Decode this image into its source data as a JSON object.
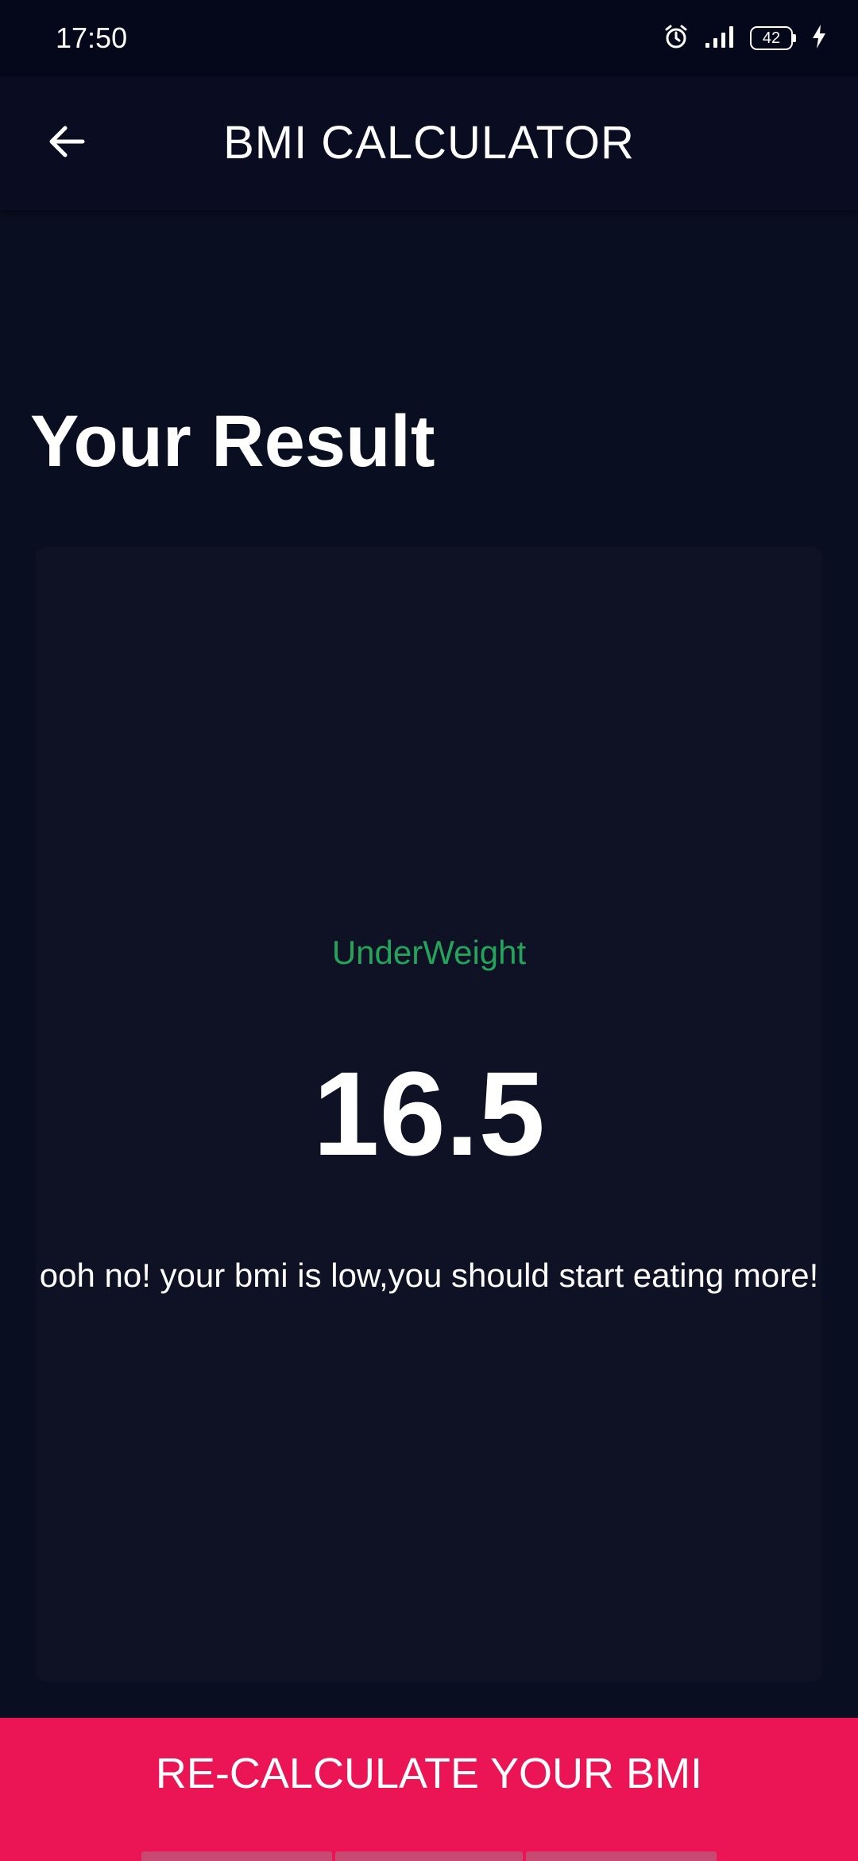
{
  "status_bar": {
    "time": "17:50",
    "battery_level": "42",
    "icons": [
      "alarm-icon",
      "signal-icon",
      "battery-icon",
      "charging-icon"
    ]
  },
  "app_bar": {
    "title": "BMI CALCULATOR",
    "back_icon": "arrow-left-icon"
  },
  "result": {
    "heading": "Your Result",
    "category": "UnderWeight",
    "bmi": "16.5",
    "message": "ooh no! your bmi is low,you should start eating more!"
  },
  "actions": {
    "recalculate_label": "RE-CALCULATE YOUR BMI"
  },
  "colors": {
    "background": "#0a0e21",
    "card": "#0e1224",
    "category": "#24a35a",
    "button": "#eb1555"
  }
}
